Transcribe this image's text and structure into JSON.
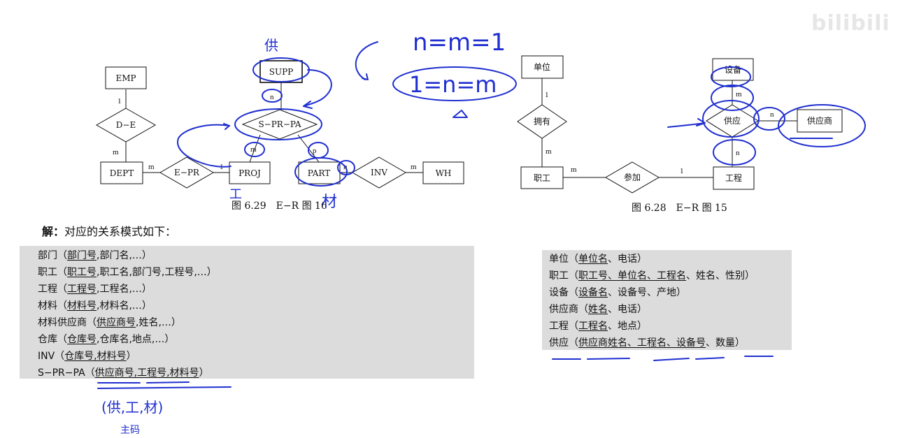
{
  "watermark": "bilibili",
  "diagram_left": {
    "caption": "图 6.29　E−R 图 16",
    "entities": {
      "emp": "EMP",
      "dept": "DEPT",
      "supp": "SUPP",
      "proj": "PROJ",
      "part": "PART",
      "wh": "WH"
    },
    "relationships": {
      "de": "D−E",
      "epr": "E−PR",
      "sprpa": "S−PR−PA",
      "inv": "INV"
    },
    "cardinalities": {
      "emp_de": "1",
      "dept_de": "m",
      "dept_epr": "m",
      "proj_epr": "1",
      "supp_sprpa": "n",
      "proj_sprpa": "m",
      "part_sprpa": "p",
      "part_inv": "n",
      "wh_inv": "m"
    }
  },
  "diagram_right": {
    "caption": "图 6.28　E−R 图 15",
    "entities": {
      "unit": "单位",
      "staff": "职工",
      "equip": "设备",
      "supplier": "供应商",
      "project": "工程"
    },
    "relationships": {
      "own": "拥有",
      "join": "参加",
      "supply": "供应"
    },
    "cardinalities": {
      "unit_own": "1",
      "staff_own": "m",
      "staff_join": "m",
      "project_join": "1",
      "equip_supply": "m",
      "supplier_supply": "n",
      "project_supply": "n"
    }
  },
  "solution_heading": {
    "bold": "解：",
    "text": "对应的关系模式如下："
  },
  "left_schemas": [
    {
      "pre": "部门（",
      "key": "部门号",
      "post": ",部门名,…）"
    },
    {
      "pre": "职工（",
      "key": "职工号",
      "post": ",职工名,部门号,工程号,…）"
    },
    {
      "pre": "工程（",
      "key": "工程号",
      "post": ",工程名,…）"
    },
    {
      "pre": "材料（",
      "key": "材料号",
      "post": ",材料名,…）"
    },
    {
      "pre": "材料供应商（",
      "key": "供应商号",
      "post": ",姓名,…）"
    },
    {
      "pre": "仓库（",
      "key": "仓库号",
      "post": ",仓库名,地点,…）"
    },
    {
      "pre": "INV（",
      "key": "仓库号,材料号",
      "post": "）"
    },
    {
      "pre": "S−PR−PA（",
      "key": "供应商号,工程号,材料号",
      "post": "）"
    }
  ],
  "right_schemas": [
    {
      "pre": "单位（",
      "key": "单位名",
      "post": "、电话）"
    },
    {
      "pre": "职工（",
      "key": "职工号、单位名、工程名",
      "post": "、姓名、性别）"
    },
    {
      "pre": "设备（",
      "key": "设备名",
      "post": "、设备号、产地）"
    },
    {
      "pre": "供应商（",
      "key": "姓名",
      "post": "、电话）"
    },
    {
      "pre": "工程（",
      "key": "工程名",
      "post": "、地点）"
    },
    {
      "pre": "供应（",
      "key": "供应商姓名、工程名、设备号",
      "post": "、数量）"
    }
  ],
  "handwriting": {
    "formula_top": "n=m=1",
    "formula_circled": "1=n=m",
    "supp_note": "供",
    "proj_note": "工",
    "part_note": "材",
    "bottom_tuple": "(供,工,材)",
    "bottom_note": "主码"
  },
  "colors": {
    "panel": "#dcdcdc",
    "ink": "#1f2fd0"
  }
}
